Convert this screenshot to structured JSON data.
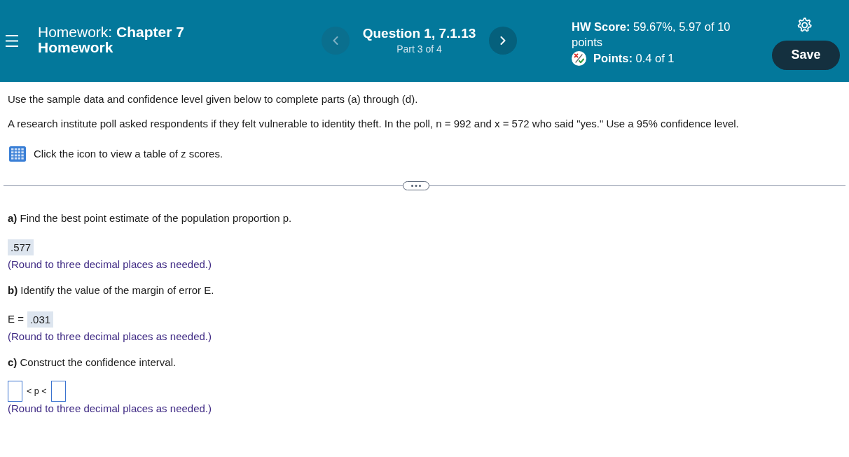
{
  "header": {
    "title": "Homework: **Chapter 7 Homework**",
    "nav": {
      "prev": {
        "disabled": true
      },
      "next": {
        "disabled": false
      }
    },
    "question": {
      "title": "Question 1, 7.1.13",
      "part": "Part 3 of 4"
    },
    "hw_score": "**HW Score:** 59.67%, 5.97 of 10 points",
    "points": "**Points:** 0.4 of 1",
    "save_button": "Save"
  },
  "instructions": [
    "Use the sample data and confidence level given below to complete parts (a) through (d).",
    "A research institute poll asked respondents if they felt vulnerable to identity theft. In the poll, n = 992 and x = 572 who said \"yes.\" Use a 95% confidence level."
  ],
  "z_table_link": "Click the icon to view a table of z scores.",
  "parts": [
    {
      "kind": "value",
      "prompt": "**a)** Find the best point estimate of the population proportion p.",
      "answer": ".577",
      "hint": "(Round to three decimal places as needed.)"
    },
    {
      "kind": "value",
      "prompt": "**b)** Identify the value of the margin of error E.",
      "answer_label": "E =",
      "answer": ".031",
      "hint": "(Round to three decimal places as needed.)"
    },
    {
      "kind": "interval",
      "prompt": "**c)** Construct the confidence interval.",
      "relation": "< p <",
      "hint": "(Round to three decimal places as needed.)"
    }
  ]
}
